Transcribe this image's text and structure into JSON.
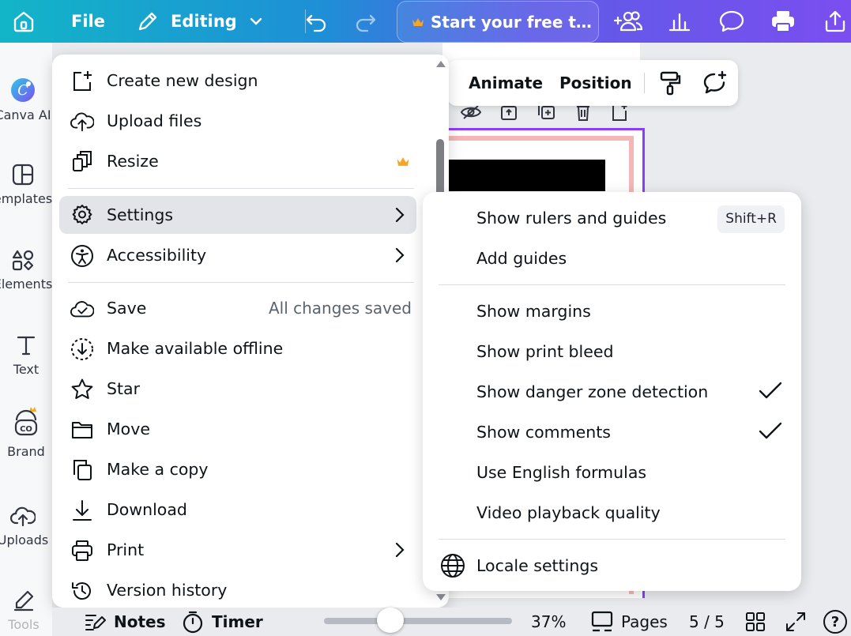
{
  "topbar": {
    "file_label": "File",
    "mode_label": "Editing",
    "trial_label": "Start your free t…",
    "accent": "#8b3dff"
  },
  "rail": {
    "items": [
      {
        "label": "Canva AI",
        "icon": "canva-ai-icon"
      },
      {
        "label": "emplates",
        "icon": "templates-icon"
      },
      {
        "label": "Elements",
        "icon": "elements-icon"
      },
      {
        "label": "Text",
        "icon": "text-icon"
      },
      {
        "label": "Brand",
        "icon": "brand-icon"
      },
      {
        "label": "Uploads",
        "icon": "uploads-icon"
      },
      {
        "label": "Tools",
        "icon": "tools-icon"
      }
    ]
  },
  "toolbar": {
    "animate_label": "Animate",
    "position_label": "Position"
  },
  "file_menu": {
    "items": [
      {
        "label": "Create new design",
        "icon": "plus-square-icon"
      },
      {
        "label": "Upload files",
        "icon": "cloud-upload-icon"
      },
      {
        "label": "Resize",
        "icon": "resize-icon",
        "premium": true
      },
      {
        "label": "Settings",
        "icon": "gear-icon",
        "submenu": true,
        "active": true
      },
      {
        "label": "Accessibility",
        "icon": "accessibility-icon",
        "submenu": true
      },
      {
        "label": "Save",
        "icon": "cloud-check-icon",
        "status": "All changes saved"
      },
      {
        "label": "Make available offline",
        "icon": "offline-icon"
      },
      {
        "label": "Star",
        "icon": "star-icon"
      },
      {
        "label": "Move",
        "icon": "folder-icon"
      },
      {
        "label": "Make a copy",
        "icon": "copy-icon"
      },
      {
        "label": "Download",
        "icon": "download-icon"
      },
      {
        "label": "Print",
        "icon": "printer-icon",
        "submenu": true
      },
      {
        "label": "Version history",
        "icon": "history-icon"
      }
    ]
  },
  "settings_menu": {
    "items": [
      {
        "label": "Show rulers and guides",
        "shortcut": "Shift+R"
      },
      {
        "label": "Add guides"
      },
      {
        "label": "Show margins"
      },
      {
        "label": "Show print bleed"
      },
      {
        "label": "Show danger zone detection",
        "checked": true
      },
      {
        "label": "Show comments",
        "checked": true
      },
      {
        "label": "Use English formulas"
      },
      {
        "label": "Video playback quality"
      },
      {
        "label": "Locale settings",
        "icon": "globe-icon"
      }
    ]
  },
  "bottom": {
    "notes_label": "Notes",
    "timer_label": "Timer",
    "zoom": "37%",
    "zoom_fraction": 0.37,
    "pages_label": "Pages",
    "page_count": "5 / 5",
    "help_label": "?"
  }
}
